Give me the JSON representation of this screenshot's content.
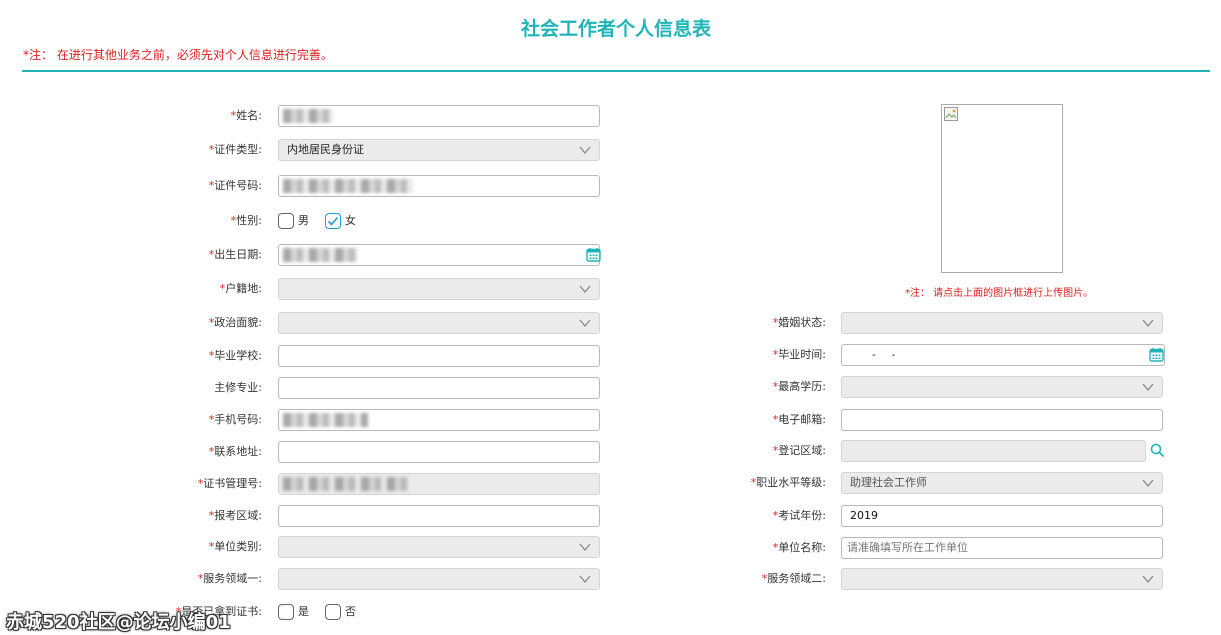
{
  "page": {
    "title": "社会工作者个人信息表",
    "note_top": "*注： 在进行其他业务之前，必须先对个人信息进行完善。",
    "photo_note": "*注： 请点击上面的图片框进行上传图片。",
    "watermark": "赤城520社区@论坛小编01"
  },
  "left": {
    "name": {
      "label": "姓名:",
      "value": ""
    },
    "id_type": {
      "label": "证件类型:",
      "value": "内地居民身份证"
    },
    "id_number": {
      "label": "证件号码:",
      "value": ""
    },
    "gender": {
      "label": "性别:",
      "male": "男",
      "female": "女",
      "selected": "女"
    },
    "birth_date": {
      "label": "出生日期:",
      "value": ""
    },
    "hukou": {
      "label": "户籍地:",
      "value": ""
    },
    "political": {
      "label": "政治面貌:",
      "value": ""
    },
    "school": {
      "label": "毕业学校:",
      "value": ""
    },
    "major": {
      "label": "主修专业:",
      "value": ""
    },
    "phone": {
      "label": "手机号码:",
      "value": ""
    },
    "address": {
      "label": "联系地址:",
      "value": ""
    },
    "cert_number": {
      "label": "证书管理号:",
      "value": ""
    },
    "exam_region": {
      "label": "报考区域:",
      "value": ""
    },
    "unit_type": {
      "label": "单位类别:",
      "value": ""
    },
    "service_area1": {
      "label": "服务领域一:",
      "value": ""
    },
    "has_cert": {
      "label": "是否已拿到证书:",
      "yes": "是",
      "no": "否"
    }
  },
  "right": {
    "marital": {
      "label": "婚姻状态:",
      "value": ""
    },
    "grad_time": {
      "label": "毕业时间:",
      "value": "- -"
    },
    "education": {
      "label": "最高学历:",
      "value": ""
    },
    "email": {
      "label": "电子邮箱:",
      "value": ""
    },
    "reg_region": {
      "label": "登记区域:",
      "value": ""
    },
    "job_level": {
      "label": "职业水平等级:",
      "value": "助理社会工作师"
    },
    "exam_year": {
      "label": "考试年份:",
      "value": "2019"
    },
    "unit_name": {
      "label": "单位名称:",
      "placeholder": "请准确填写所在工作单位"
    },
    "service_area2": {
      "label": "服务领域二:",
      "value": ""
    }
  },
  "colors": {
    "accent": "#1fb5b8",
    "required": "#e02020",
    "checkbox_checked": "#1b9dd6"
  },
  "icons": [
    "chevron-down-icon",
    "calendar-icon",
    "search-icon",
    "broken-image-icon",
    "checkmark-icon"
  ]
}
